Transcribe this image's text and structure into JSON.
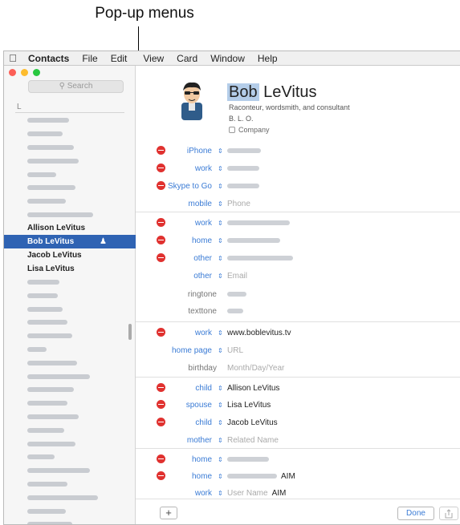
{
  "callout": {
    "title": "Pop-up menus"
  },
  "menubar": {
    "apple_icon": "apple-icon",
    "items": [
      "Contacts",
      "File",
      "Edit",
      "View",
      "Card",
      "Window",
      "Help"
    ]
  },
  "sidebar": {
    "search_placeholder": "Search",
    "section_letter": "L",
    "contacts": [
      {
        "name": "",
        "blurred": true
      },
      {
        "name": "",
        "blurred": true
      },
      {
        "name": "",
        "blurred": true
      },
      {
        "name": "",
        "blurred": true
      },
      {
        "name": "",
        "blurred": true
      },
      {
        "name": "",
        "blurred": true
      },
      {
        "name": "",
        "blurred": true
      },
      {
        "name": "",
        "blurred": true
      },
      {
        "name": "Allison LeVitus",
        "blurred": false
      },
      {
        "name": "Bob LeVitus",
        "blurred": false,
        "selected": true,
        "me_icon": "person-icon"
      },
      {
        "name": "Jacob LeVitus",
        "blurred": false
      },
      {
        "name": "Lisa LeVitus",
        "blurred": false
      },
      {
        "name": "",
        "blurred": true
      },
      {
        "name": "",
        "blurred": true
      },
      {
        "name": "",
        "blurred": true
      },
      {
        "name": "",
        "blurred": true
      },
      {
        "name": "",
        "blurred": true
      },
      {
        "name": "",
        "blurred": true
      },
      {
        "name": "",
        "blurred": true
      },
      {
        "name": "",
        "blurred": true
      },
      {
        "name": "",
        "blurred": true
      },
      {
        "name": "",
        "blurred": true
      },
      {
        "name": "",
        "blurred": true
      },
      {
        "name": "",
        "blurred": true
      },
      {
        "name": "",
        "blurred": true
      },
      {
        "name": "",
        "blurred": true
      },
      {
        "name": "",
        "blurred": true
      },
      {
        "name": "",
        "blurred": true
      },
      {
        "name": "",
        "blurred": true
      },
      {
        "name": "",
        "blurred": true
      },
      {
        "name": "",
        "blurred": true
      }
    ]
  },
  "card": {
    "first_name": "Bob",
    "last_name": "LeVitus",
    "subtitle": "Raconteur, wordsmith, and consultant",
    "nickname": "B. L. O.",
    "company_label": "Company",
    "fields": [
      {
        "label": "iPhone",
        "value": "",
        "blurred": true,
        "remove": true,
        "popup": true
      },
      {
        "label": "work",
        "value": "",
        "blurred": true,
        "remove": true,
        "popup": true
      },
      {
        "label": "Skype to Go",
        "value": "",
        "blurred": true,
        "remove": true,
        "popup": true
      },
      {
        "label": "mobile",
        "value": "Phone",
        "placeholder": true,
        "remove": false,
        "popup": true
      },
      {
        "label": "work",
        "value": "",
        "blurred": true,
        "remove": true,
        "popup": true
      },
      {
        "label": "home",
        "value": "",
        "blurred": true,
        "remove": true,
        "popup": true
      },
      {
        "label": "other",
        "value": "",
        "blurred": true,
        "remove": true,
        "popup": true
      },
      {
        "label": "other",
        "value": "Email",
        "placeholder": true,
        "remove": false,
        "popup": true
      },
      {
        "label": "ringtone",
        "value": "",
        "blurred": true,
        "remove": false,
        "popup": false
      },
      {
        "label": "texttone",
        "value": "",
        "blurred": true,
        "remove": false,
        "popup": false
      },
      {
        "label": "work",
        "value": "www.boblevitus.tv",
        "remove": true,
        "popup": true
      },
      {
        "label": "home page",
        "value": "URL",
        "placeholder": true,
        "remove": false,
        "popup": true
      },
      {
        "label": "birthday",
        "value": "Month/Day/Year",
        "placeholder": true,
        "remove": false,
        "popup": false
      },
      {
        "label": "child",
        "value": "Allison LeVitus",
        "remove": true,
        "popup": true
      },
      {
        "label": "spouse",
        "value": "Lisa LeVitus",
        "remove": true,
        "popup": true
      },
      {
        "label": "child",
        "value": "Jacob LeVitus",
        "remove": true,
        "popup": true
      },
      {
        "label": "mother",
        "value": "Related Name",
        "placeholder": true,
        "remove": false,
        "popup": true
      },
      {
        "label": "home",
        "value": "",
        "blurred": true,
        "remove": true,
        "popup": true
      },
      {
        "label": "home",
        "value": "",
        "blurred": true,
        "remove": true,
        "popup": true,
        "extra": "AIM"
      },
      {
        "label": "work",
        "value": "User Name",
        "placeholder": true,
        "remove": false,
        "popup": true,
        "extra": "AIM"
      }
    ]
  },
  "bottom": {
    "add_label": "+",
    "done_label": "Done",
    "share_icon": "share-icon"
  },
  "colors": {
    "selection": "#2f63b3",
    "remove": "#e0312f",
    "label_blue": "#3a7bd5"
  }
}
